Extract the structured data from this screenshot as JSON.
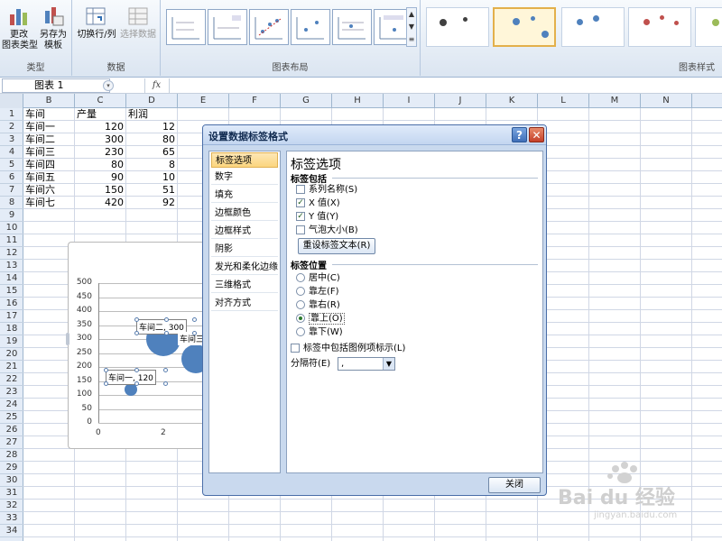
{
  "ribbon": {
    "groups": [
      {
        "label": "类型"
      },
      {
        "label": "数据"
      },
      {
        "label": "图表布局"
      },
      {
        "label": "图表样式"
      }
    ],
    "change_chart_type": "更改\n图表类型",
    "save_as_template": "另存为\n模板",
    "switch_row_col": "切换行/列",
    "select_data": "选择数据"
  },
  "formula_bar": {
    "name_box": "图表 1",
    "fx": "fx"
  },
  "columns": [
    "B",
    "C",
    "D",
    "E",
    "F",
    "G",
    "H",
    "I",
    "J",
    "K",
    "L",
    "M",
    "N"
  ],
  "rows": [
    "1",
    "2",
    "3",
    "4",
    "5",
    "6",
    "7",
    "8",
    "9",
    "10",
    "11",
    "12",
    "13",
    "14",
    "15",
    "16",
    "17",
    "18",
    "19",
    "20",
    "21",
    "22",
    "23",
    "24",
    "25",
    "26",
    "27",
    "28",
    "29",
    "30",
    "31",
    "32",
    "33",
    "34"
  ],
  "table": {
    "headers": [
      "车间",
      "产量",
      "利润"
    ],
    "rows": [
      [
        "车间一",
        "120",
        "12"
      ],
      [
        "车间二",
        "300",
        "80"
      ],
      [
        "车间三",
        "230",
        "65"
      ],
      [
        "车间四",
        "80",
        "8"
      ],
      [
        "车间五",
        "90",
        "10"
      ],
      [
        "车间六",
        "150",
        "51"
      ],
      [
        "车间七",
        "420",
        "92"
      ]
    ]
  },
  "chart": {
    "y_ticks": [
      "500",
      "450",
      "400",
      "350",
      "300",
      "250",
      "200",
      "150",
      "100",
      "50",
      "0"
    ],
    "x_ticks": [
      "0",
      "2"
    ],
    "labels": [
      "车间二, 300",
      "车间三",
      "车间一, 120"
    ]
  },
  "chart_data": {
    "type": "scatter",
    "x": [
      1,
      2,
      3
    ],
    "y": [
      120,
      300,
      230
    ],
    "ylim": [
      0,
      500
    ]
  },
  "dialog": {
    "title": "设置数据标签格式",
    "help": "?",
    "close_x": "✕",
    "nav": [
      "标签选项",
      "数字",
      "填充",
      "边框颜色",
      "边框样式",
      "阴影",
      "发光和柔化边缘",
      "三维格式",
      "对齐方式"
    ],
    "panel_title": "标签选项",
    "contains_head": "标签包括",
    "contains": [
      {
        "label": "系列名称(S)",
        "checked": false
      },
      {
        "label": "X 值(X)",
        "checked": true
      },
      {
        "label": "Y 值(Y)",
        "checked": true
      },
      {
        "label": "气泡大小(B)",
        "checked": false
      }
    ],
    "reset_button": "重设标签文本(R)",
    "position_head": "标签位置",
    "positions": [
      {
        "label": "居中(C)",
        "selected": false
      },
      {
        "label": "靠左(F)",
        "selected": false
      },
      {
        "label": "靠右(R)",
        "selected": false
      },
      {
        "label": "靠上(O)",
        "selected": true
      },
      {
        "label": "靠下(W)",
        "selected": false
      }
    ],
    "legend_key": "标签中包括图例项标示(L)",
    "separator_label": "分隔符(E)",
    "separator_value": ",",
    "close_button": "关闭"
  },
  "watermark": {
    "logo": "Bai du 经验",
    "url": "jingyan.baidu.com"
  },
  "colors": {
    "bubble": "#4f81bd",
    "selected": "#fbd57e"
  }
}
